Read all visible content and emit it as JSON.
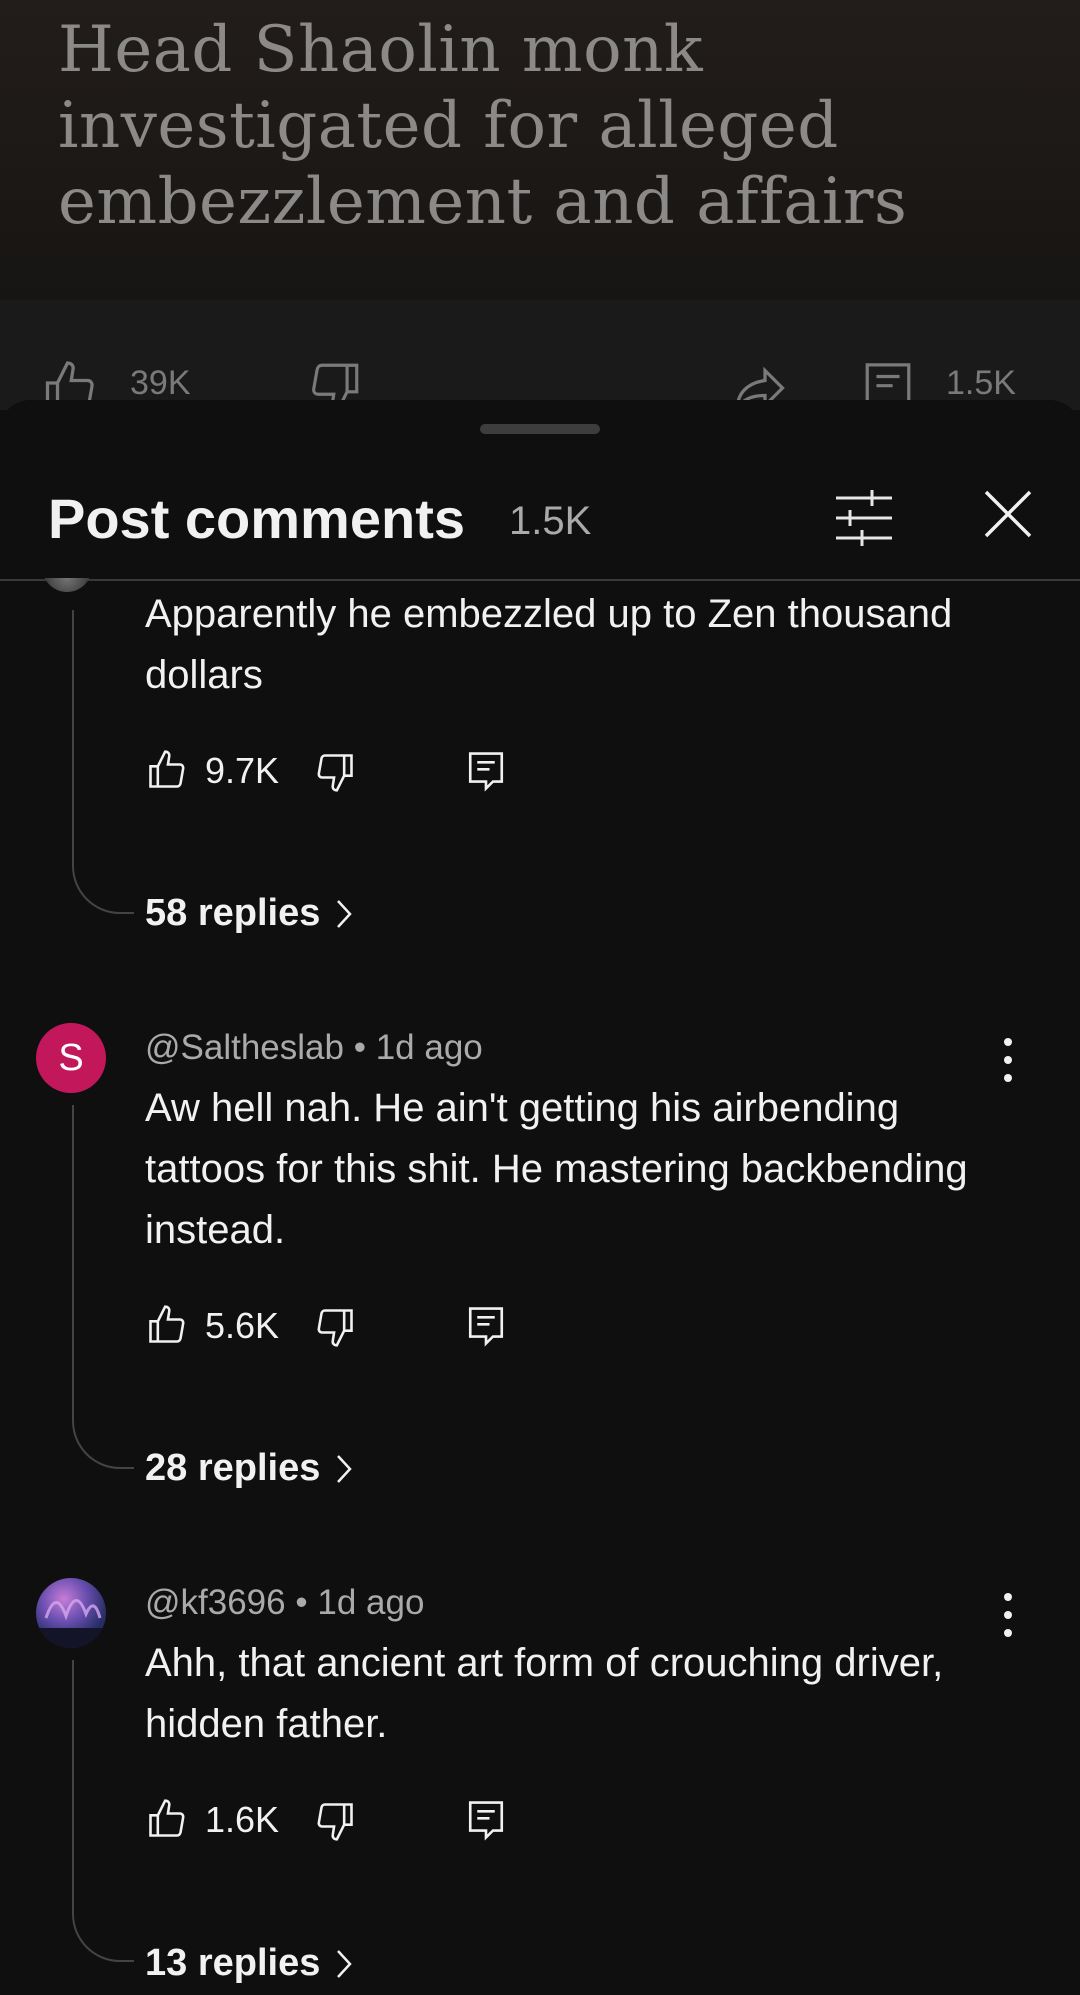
{
  "post": {
    "headline": "Head Shaolin monk investigated for alleged embezzlement and affairs",
    "likes": "39K",
    "comments": "1.5K"
  },
  "sheet": {
    "title": "Post comments",
    "count": "1.5K"
  },
  "comments": [
    {
      "body": "Apparently he embezzled up to Zen thousand dollars",
      "likes": "9.7K",
      "replies_label": "58 replies"
    },
    {
      "avatar_letter": "S",
      "avatar_color": "#c2185b",
      "author": "@Saltheslab",
      "time": "1d ago",
      "body": "Aw hell nah. He ain't getting his airbending tattoos for this shit. He mastering backbending instead.",
      "likes": "5.6K",
      "replies_label": "28 replies"
    },
    {
      "avatar_image": "aurora-photo",
      "author": "@kf3696",
      "time": "1d ago",
      "body": "Ahh, that ancient art form of crouching driver, hidden father.",
      "likes": "1.6K",
      "replies_label": "13 replies"
    }
  ],
  "meta_separator": "•",
  "colors": {
    "background": "#0f0f0f",
    "text_primary": "#f1f1f1",
    "text_secondary": "#aaaaaa"
  }
}
